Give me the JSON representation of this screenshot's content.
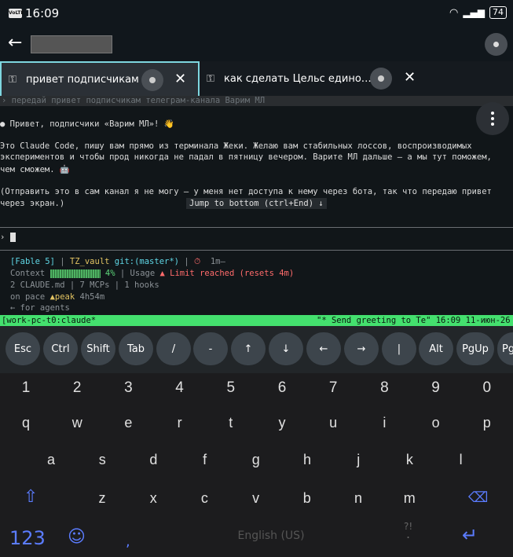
{
  "status": {
    "time": "16:09",
    "carrier_badge": "VoLTE",
    "battery": "74"
  },
  "tabs": [
    {
      "label": "привет подписчикам",
      "close": "✕"
    },
    {
      "label": "как сделать Цельс едино…",
      "close": "✕"
    }
  ],
  "terminal": {
    "prev_command": "› передай привет подписчикам телеграм-канала Варим МЛ",
    "bullet_line": "● Привет, подписчики «Варим МЛ»! 👋",
    "para1": [
      "Это Claude Code, пишу вам прямо из терминала Жеки. Желаю вам стабильных лоссов, воспроизводимых",
      "экспериментов и чтобы прод никогда не падал в пятницу вечером. Варите МЛ дальше — а мы тут поможем,",
      "чем сможем. 🤖"
    ],
    "para2": [
      "(Отправить это в сам канал я не могу — у меня нет доступа к нему через бота, так что передаю привет",
      "через экран.)"
    ],
    "jump_button": "Jump to bottom (ctrl+End) ↓",
    "prompt": "›",
    "statusline": {
      "model": "[Fable 5]",
      "pipe": "|",
      "repo": "TZ_vault",
      "git": "git:(master*)",
      "timer_icon": "⏱",
      "timer": "1m—",
      "context_label": "Context",
      "context_pct": "4%",
      "usage_label": "| Usage",
      "usage_warn": "▲ Limit reached (resets 4m)",
      "line3": "2 CLAUDE.md | 7 MCPs | 1 hooks",
      "pace_prefix": "on pace",
      "pace_peak": "▲peak",
      "pace_time": "4h54m",
      "agents": "← for agents"
    },
    "tmux_left": "[work-pc-t0:claude*",
    "tmux_right": "\"* Send greeting to Te\" 16:09 11-июн-26"
  },
  "extra_keys": [
    "Esc",
    "Ctrl",
    "Shift",
    "Tab",
    "/",
    "-",
    "↑",
    "↓",
    "←",
    "→",
    "|",
    "Alt",
    "PgUp",
    "Pg"
  ],
  "keyboard": {
    "row_numbers": [
      "1",
      "2",
      "3",
      "4",
      "5",
      "6",
      "7",
      "8",
      "9",
      "0"
    ],
    "row1": [
      "q",
      "w",
      "e",
      "r",
      "t",
      "y",
      "u",
      "i",
      "o",
      "p"
    ],
    "row2": [
      "a",
      "s",
      "d",
      "f",
      "g",
      "h",
      "j",
      "k",
      "l"
    ],
    "row3": [
      "z",
      "x",
      "c",
      "v",
      "b",
      "n",
      "m"
    ],
    "mode_key": "123",
    "comma": ",",
    "space_label": "English (US)",
    "period": "?!",
    "period_main": "."
  },
  "colors": {
    "tab_active_border": "#7ed6df",
    "tmux_bar": "#44e06e",
    "keyboard_accent": "#5b7cff"
  }
}
